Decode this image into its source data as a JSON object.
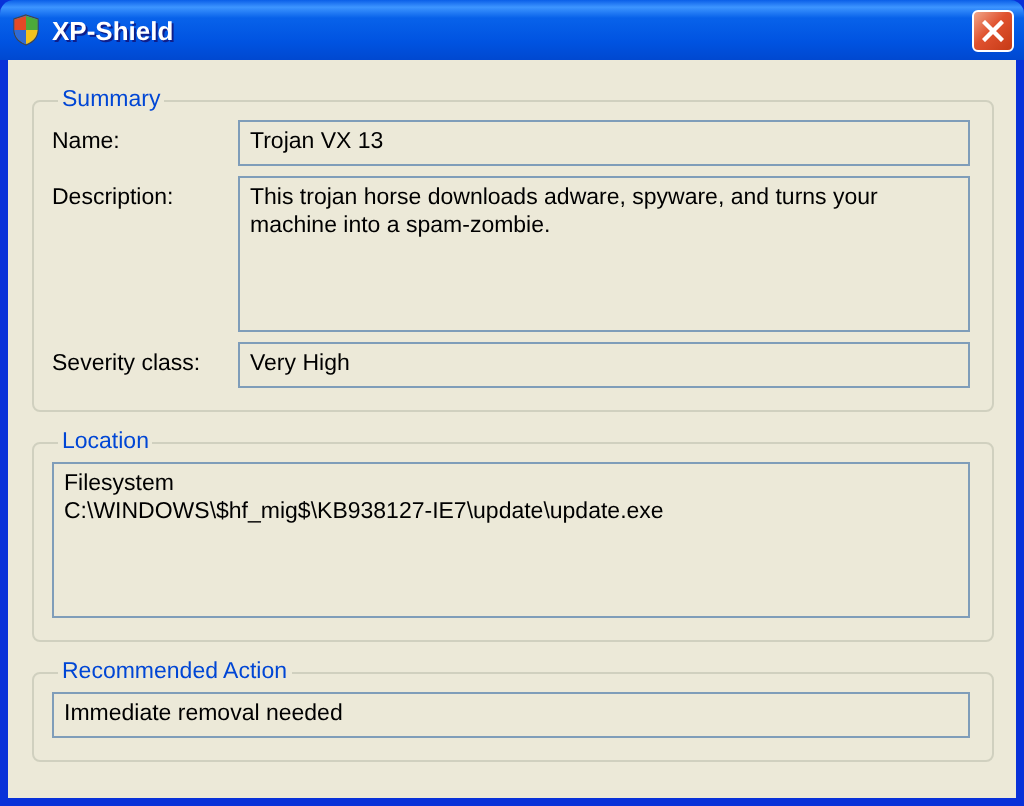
{
  "window": {
    "title": "XP-Shield"
  },
  "groups": [
    {
      "title": "Summary",
      "fields": [
        {
          "label": "Name:",
          "value": "Trojan VX 13",
          "kind": "single"
        },
        {
          "label": "Description:",
          "value": "This trojan horse downloads adware, spyware, and turns your machine into a spam-zombie.",
          "kind": "multi"
        },
        {
          "label": "Severity class:",
          "value": "Very High",
          "kind": "single"
        }
      ]
    },
    {
      "title": "Location",
      "fields": [
        {
          "value": "Filesystem\nC:\\WINDOWS\\$hf_mig$\\KB938127-IE7\\update\\update.exe",
          "kind": "multi"
        }
      ]
    },
    {
      "title": "Recommended Action",
      "fields": [
        {
          "value": "Immediate removal needed",
          "kind": "single"
        }
      ]
    }
  ]
}
